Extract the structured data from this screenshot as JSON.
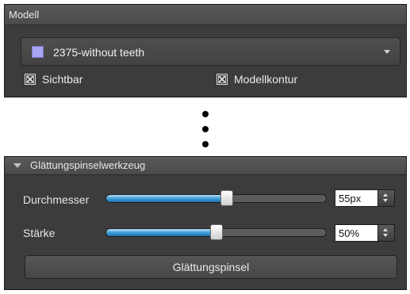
{
  "model_panel": {
    "title": "Modell",
    "model_select": {
      "selected": "2375-without teeth",
      "swatch_color": "#a9a4f4",
      "icon": "chevron-down-icon"
    },
    "visible_checkbox": {
      "label": "Sichtbar",
      "checked": true
    },
    "contour_checkbox": {
      "label": "Modellkontur",
      "checked": true
    }
  },
  "separator": {
    "icon": "vertical-ellipsis-icon"
  },
  "tool_panel": {
    "title": "Glättungspinselwerkzeug",
    "collapse_icon": "triangle-down-icon",
    "diameter": {
      "label": "Durchmesser",
      "value": "55px",
      "slider_fraction": 0.55
    },
    "strength": {
      "label": "Stärke",
      "value": "50%",
      "slider_fraction": 0.5
    },
    "apply_button": "Glättungspinsel"
  },
  "colors": {
    "accent": "#3f9ed8",
    "panel_bg": "#3c3c3c"
  }
}
